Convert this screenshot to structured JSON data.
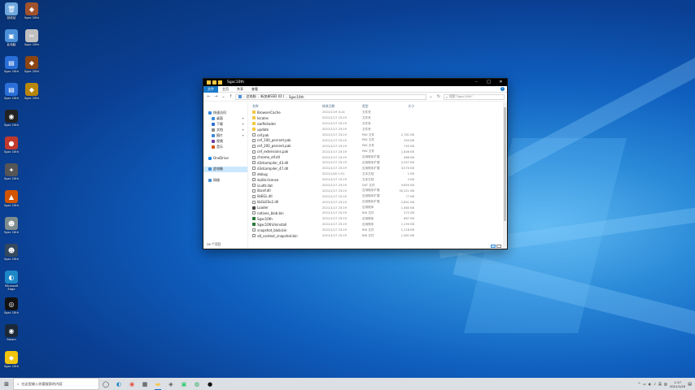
{
  "desktop": {
    "icons": [
      {
        "id": "recycle-bin",
        "label": "回收站",
        "color": "#6fa8dc",
        "glyph": "🗑",
        "col": 0,
        "row": 0
      },
      {
        "id": "game-1",
        "label": "Sgxc 10th",
        "color": "#a0522d",
        "glyph": "◆",
        "col": 1,
        "row": 0
      },
      {
        "id": "computer",
        "label": "此电脑",
        "color": "#4a8fd8",
        "glyph": "▣",
        "col": 0,
        "row": 1
      },
      {
        "id": "tool-1",
        "label": "Sgxc 10th",
        "color": "#c0c0c0",
        "glyph": "✂",
        "col": 1,
        "row": 1
      },
      {
        "id": "shortcut-1",
        "label": "Sgxc 10th",
        "color": "#2a6fd8",
        "glyph": "▤",
        "col": 0,
        "row": 2
      },
      {
        "id": "game-2",
        "label": "Sgxc 10th",
        "color": "#8b4513",
        "glyph": "◆",
        "col": 1,
        "row": 2
      },
      {
        "id": "shortcut-2",
        "label": "Sgxc 10th",
        "color": "#2a6fd8",
        "glyph": "▤",
        "col": 0,
        "row": 3
      },
      {
        "id": "game-3",
        "label": "Sgxc 10th",
        "color": "#b8860b",
        "glyph": "◆",
        "col": 1,
        "row": 3
      },
      {
        "id": "controller",
        "label": "Sgxc 10th",
        "color": "#222222",
        "glyph": "◉",
        "col": 0,
        "row": 4
      },
      {
        "id": "app-red",
        "label": "Sgxc 10th",
        "color": "#c0392b",
        "glyph": "●",
        "col": 0,
        "row": 5
      },
      {
        "id": "app-tool",
        "label": "Sgxc 10th",
        "color": "#555555",
        "glyph": "✦",
        "col": 0,
        "row": 6
      },
      {
        "id": "app-fire",
        "label": "Sgxc 10th",
        "color": "#d35400",
        "glyph": "▲",
        "col": 0,
        "row": 7
      },
      {
        "id": "app-char",
        "label": "Sgxc 10th",
        "color": "#7f8c8d",
        "glyph": "☻",
        "col": 0,
        "row": 8
      },
      {
        "id": "app-mask",
        "label": "Sgxc 10th",
        "color": "#34495e",
        "glyph": "☻",
        "col": 0,
        "row": 9
      },
      {
        "id": "edge",
        "label": "Microsoft Edge",
        "color": "#1e88c7",
        "glyph": "◐",
        "col": 0,
        "row": 10
      },
      {
        "id": "app-dark",
        "label": "Sgxc 10th",
        "color": "#111111",
        "glyph": "◎",
        "col": 0,
        "row": 11
      },
      {
        "id": "steam",
        "label": "Steam",
        "color": "#1b2838",
        "glyph": "◉",
        "col": 0,
        "row": 12
      },
      {
        "id": "app-yellow",
        "label": "Sgxc 10th",
        "color": "#f1c40f",
        "glyph": "◆",
        "col": 0,
        "row": 13
      }
    ]
  },
  "explorer": {
    "title": "Sgxc10th",
    "ribbon_tabs": [
      "文件",
      "主页",
      "共享",
      "查看"
    ],
    "address": [
      "此电脑",
      "新加卷SSD (D:)",
      "Sgxc10th"
    ],
    "search_placeholder": "搜索\"Sgxc10th\"",
    "nav": [
      {
        "label": "快速访问",
        "icon_color": "#3b88d9",
        "child": false,
        "pin": false,
        "selected": false
      },
      {
        "label": "桌面",
        "icon_color": "#3b88d9",
        "child": true,
        "pin": true,
        "selected": false
      },
      {
        "label": "下载",
        "icon_color": "#2a6fd8",
        "child": true,
        "pin": true,
        "selected": false
      },
      {
        "label": "文档",
        "icon_color": "#8a8a8a",
        "child": true,
        "pin": true,
        "selected": false
      },
      {
        "label": "图片",
        "icon_color": "#3b88d9",
        "child": true,
        "pin": true,
        "selected": false
      },
      {
        "label": "视频",
        "icon_color": "#6b3fa0",
        "child": true,
        "pin": false,
        "selected": false
      },
      {
        "label": "音乐",
        "icon_color": "#d35400",
        "child": true,
        "pin": false,
        "selected": false
      },
      {
        "label": "",
        "icon_color": "",
        "child": false,
        "pin": false,
        "selected": false
      },
      {
        "label": "OneDrive",
        "icon_color": "#1e88e5",
        "child": false,
        "pin": false,
        "selected": false
      },
      {
        "label": "",
        "icon_color": "",
        "child": false,
        "pin": false,
        "selected": false
      },
      {
        "label": "此电脑",
        "icon_color": "#4a8fd8",
        "child": false,
        "pin": false,
        "selected": true
      },
      {
        "label": "",
        "icon_color": "",
        "child": false,
        "pin": false,
        "selected": false
      },
      {
        "label": "网络",
        "icon_color": "#4a8fd8",
        "child": false,
        "pin": false,
        "selected": false
      }
    ],
    "status": "28 个项目",
    "columns": {
      "name": "名称",
      "date": "修改日期",
      "type": "类型",
      "size": "大小"
    },
    "files": [
      {
        "name": "BrowserCache",
        "date": "2021/1/19 4:14",
        "type": "文件夹",
        "size": "",
        "kind": "folder"
      },
      {
        "name": "locales",
        "date": "2021/1/17 23:19",
        "type": "文件夹",
        "size": "",
        "kind": "folder"
      },
      {
        "name": "swiftshader",
        "date": "2021/1/17 23:19",
        "type": "文件夹",
        "size": "",
        "kind": "folder"
      },
      {
        "name": "update",
        "date": "2021/1/17 23:19",
        "type": "文件夹",
        "size": "",
        "kind": "folder"
      },
      {
        "name": "cef.pak",
        "date": "2021/1/17 23:19",
        "type": "PAK 文件",
        "size": "2,781 KB",
        "kind": "file"
      },
      {
        "name": "cef_100_percent.pak",
        "date": "2021/1/17 23:19",
        "type": "PAK 文件",
        "size": "350 KB",
        "kind": "file"
      },
      {
        "name": "cef_200_percent.pak",
        "date": "2021/1/17 23:19",
        "type": "PAK 文件",
        "size": "745 KB",
        "kind": "file"
      },
      {
        "name": "cef_extensions.pak",
        "date": "2021/1/17 23:19",
        "type": "PAK 文件",
        "size": "1,846 KB",
        "kind": "file"
      },
      {
        "name": "chrome_elf.dll",
        "date": "2021/1/17 23:19",
        "type": "应用程序扩展",
        "size": "486 KB",
        "kind": "file"
      },
      {
        "name": "d3dcompiler_43.dll",
        "date": "2021/1/17 23:19",
        "type": "应用程序扩展",
        "size": "2,057 KB",
        "kind": "file"
      },
      {
        "name": "d3dcompiler_47.dll",
        "date": "2021/1/17 23:19",
        "type": "应用程序扩展",
        "size": "3,570 KB",
        "kind": "file"
      },
      {
        "name": "debug",
        "date": "2021/1/20 1:51",
        "type": "文本文档",
        "size": "1 KB",
        "kind": "file"
      },
      {
        "name": "duilib-license",
        "date": "2021/1/17 23:19",
        "type": "文本文档",
        "size": "2 KB",
        "kind": "file"
      },
      {
        "name": "icudtl.dat",
        "date": "2021/1/17 23:19",
        "type": "DAT 文件",
        "size": "9,850 KB",
        "kind": "file"
      },
      {
        "name": "libcef.dll",
        "date": "2021/1/17 23:19",
        "type": "应用程序扩展",
        "size": "90,321 KB",
        "kind": "file"
      },
      {
        "name": "libEGL.dll",
        "date": "2021/1/17 23:19",
        "type": "应用程序扩展",
        "size": "77 KB",
        "kind": "file"
      },
      {
        "name": "libGLESv2.dll",
        "date": "2021/1/17 23:19",
        "type": "应用程序扩展",
        "size": "2,841 KB",
        "kind": "file"
      },
      {
        "name": "Loader",
        "date": "2021/1/17 23:19",
        "type": "应用程序",
        "size": "1,460 KB",
        "kind": "app"
      },
      {
        "name": "natives_blob.bin",
        "date": "2021/1/17 23:19",
        "type": "BIN 文件",
        "size": "372 KB",
        "kind": "file"
      },
      {
        "name": "Sgxc10th",
        "date": "2021/1/17 23:19",
        "type": "应用程序",
        "size": "867 KB",
        "kind": "app2"
      },
      {
        "name": "Sgxc10thUninstall",
        "date": "2021/1/17 23:19",
        "type": "应用程序",
        "size": "1,190 KB",
        "kind": "app2"
      },
      {
        "name": "snapshot_blob.bin",
        "date": "2021/1/17 23:19",
        "type": "BIN 文件",
        "size": "1,118 KB",
        "kind": "file"
      },
      {
        "name": "v8_context_snapshot.bin",
        "date": "2021/1/17 23:19",
        "type": "BIN 文件",
        "size": "1,461 KB",
        "kind": "file"
      }
    ]
  },
  "taskbar": {
    "search_placeholder": "在这里输入你要搜索的内容",
    "time": "1:17",
    "date": "2021/1/20",
    "apps": [
      {
        "id": "task-view",
        "glyph": "◯",
        "color": "#222222",
        "active": false
      },
      {
        "id": "edge",
        "glyph": "◐",
        "color": "#1e88c7",
        "active": false
      },
      {
        "id": "chrome",
        "glyph": "◉",
        "color": "#e74c3c",
        "active": false
      },
      {
        "id": "store",
        "glyph": "▦",
        "color": "#333333",
        "active": false
      },
      {
        "id": "explorer",
        "glyph": "▬",
        "color": "#f6c744",
        "active": true
      },
      {
        "id": "app-2",
        "glyph": "◈",
        "color": "#555555",
        "active": false
      },
      {
        "id": "app-3",
        "glyph": "▣",
        "color": "#2ecc71",
        "active": false
      },
      {
        "id": "wechat",
        "glyph": "◍",
        "color": "#27ae60",
        "active": false
      },
      {
        "id": "app-4",
        "glyph": "●",
        "color": "#111111",
        "active": false
      }
    ],
    "tray_icons": [
      "^",
      "▭",
      "◐",
      "♪",
      "英",
      "▥"
    ]
  }
}
